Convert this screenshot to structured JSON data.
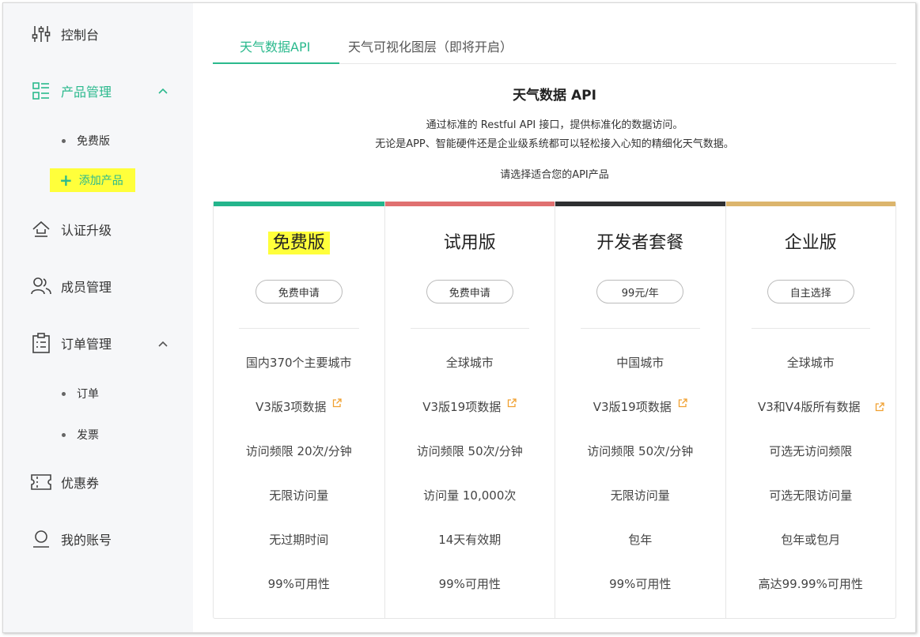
{
  "sidebar": {
    "items": [
      {
        "label": "控制台",
        "icon": "sliders-icon"
      },
      {
        "label": "产品管理",
        "icon": "product-list-icon",
        "expanded": true
      },
      {
        "label": "认证升级",
        "icon": "upgrade-icon"
      },
      {
        "label": "成员管理",
        "icon": "members-icon"
      },
      {
        "label": "订单管理",
        "icon": "clipboard-icon",
        "expanded": true
      },
      {
        "label": "优惠券",
        "icon": "coupon-icon"
      },
      {
        "label": "我的账号",
        "icon": "account-icon"
      }
    ],
    "product_sub": [
      {
        "label": "免费版"
      }
    ],
    "add_product_label": "添加产品",
    "order_sub": [
      {
        "label": "订单"
      },
      {
        "label": "发票"
      }
    ]
  },
  "tabs": [
    {
      "label": "天气数据API",
      "active": true
    },
    {
      "label": "天气可视化图层（即将开启）",
      "active": false
    }
  ],
  "header": {
    "title": "天气数据 API",
    "desc_line1": "通过标准的 Restful API 接口，提供标准化的数据访问。",
    "desc_line2": "无论是APP、智能硬件还是企业级系统都可以轻松接入心知的精细化天气数据。",
    "prompt": "请选择适合您的API产品"
  },
  "colors": {
    "accent": "#2bb98d",
    "highlight": "#ffff3b"
  },
  "plans": [
    {
      "name": "免费版",
      "button": "免费申请",
      "color": "#24b58c",
      "highlighted": true,
      "features": [
        "国内370个主要城市",
        "V3版3项数据",
        "访问频限 20次/分钟",
        "无限访问量",
        "无过期时间",
        "99%可用性"
      ]
    },
    {
      "name": "试用版",
      "button": "免费申请",
      "color": "#e07070",
      "highlighted": false,
      "features": [
        "全球城市",
        "V3版19项数据",
        "访问频限 50次/分钟",
        "访问量 10,000次",
        "14天有效期",
        "99%可用性"
      ]
    },
    {
      "name": "开发者套餐",
      "button": "99元/年",
      "color": "#2e2f31",
      "highlighted": false,
      "features": [
        "中国城市",
        "V3版19项数据",
        "访问频限 50次/分钟",
        "无限访问量",
        "包年",
        "99%可用性"
      ]
    },
    {
      "name": "企业版",
      "button": "自主选择",
      "color": "#dcb56d",
      "highlighted": false,
      "features": [
        "全球城市",
        "V3和V4版所有数据",
        "可选无访问频限",
        "可选无限访问量",
        "包年或包月",
        "高达99.99%可用性"
      ]
    }
  ]
}
